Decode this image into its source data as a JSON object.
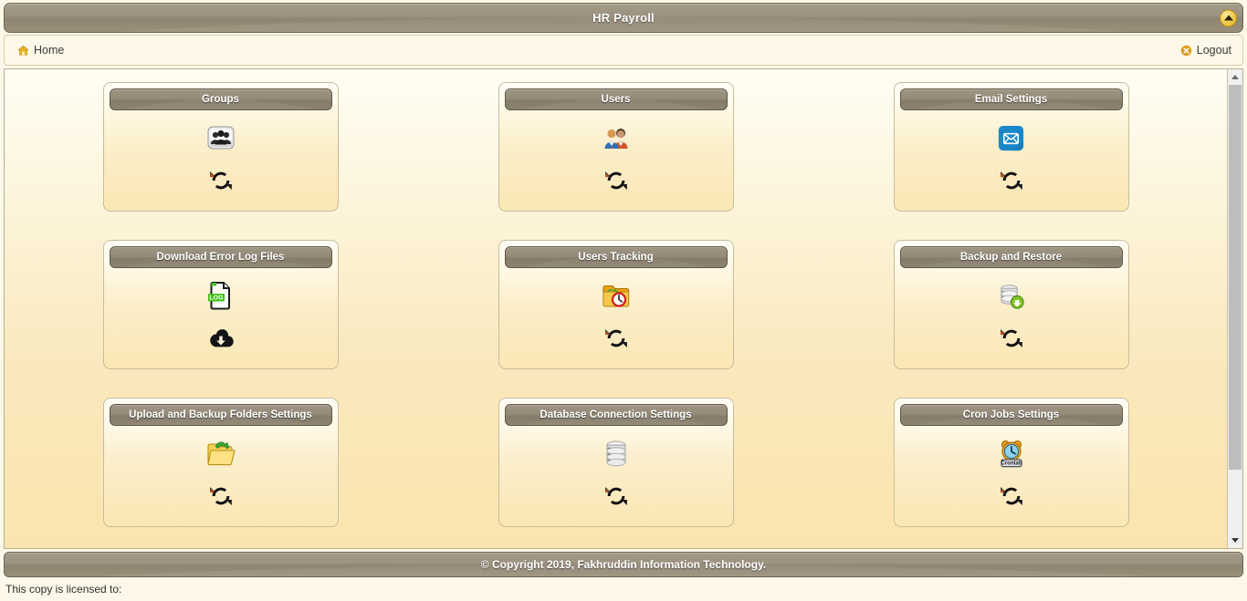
{
  "header": {
    "title": "HR Payroll",
    "collapse_icon": "chevron-up-icon"
  },
  "nav": {
    "home_label": "Home",
    "home_icon": "home-icon",
    "logout_label": "Logout",
    "logout_icon": "close-circle-icon"
  },
  "colors": {
    "titlebar": "#958b79",
    "page_background": "#fdf8e8",
    "card_body_top": "#fffdf6",
    "card_body_bottom": "#fbe7b4",
    "accent_gold": "#e0ae22",
    "logout_orange": "#e09a18",
    "refresh_black": "#1a1a1a",
    "email_blue": "#1a87c8",
    "log_green": "#3fc214"
  },
  "cards": [
    {
      "title": "Groups",
      "icon": "group-users-icon",
      "action_icon": "refresh-icon"
    },
    {
      "title": "Users",
      "icon": "two-users-icon",
      "action_icon": "refresh-icon"
    },
    {
      "title": "Email Settings",
      "icon": "envelope-icon",
      "action_icon": "refresh-icon"
    },
    {
      "title": "Download Error Log Files",
      "icon": "log-document-icon",
      "action_icon": "cloud-download-icon"
    },
    {
      "title": "Users Tracking",
      "icon": "folder-clock-icon",
      "action_icon": "refresh-icon"
    },
    {
      "title": "Backup and Restore",
      "icon": "database-download-icon",
      "action_icon": "refresh-icon"
    },
    {
      "title": "Upload and Backup Folders Settings",
      "icon": "folder-upload-icon",
      "action_icon": "refresh-icon"
    },
    {
      "title": "Database Connection Settings",
      "icon": "database-icon",
      "action_icon": "refresh-icon"
    },
    {
      "title": "Cron Jobs Settings",
      "icon": "alarm-clock-crontab-icon",
      "action_icon": "refresh-icon"
    }
  ],
  "icon_labels": {
    "log_badge": "LOG",
    "crontab_badge": "Crontab"
  },
  "scrollbar": {
    "up_icon": "triangle-up-icon",
    "down_icon": "triangle-down-icon"
  },
  "footer": {
    "copyright": "© Copyright 2019, Fakhruddin Information Technology.",
    "license": "This copy is licensed to:"
  }
}
